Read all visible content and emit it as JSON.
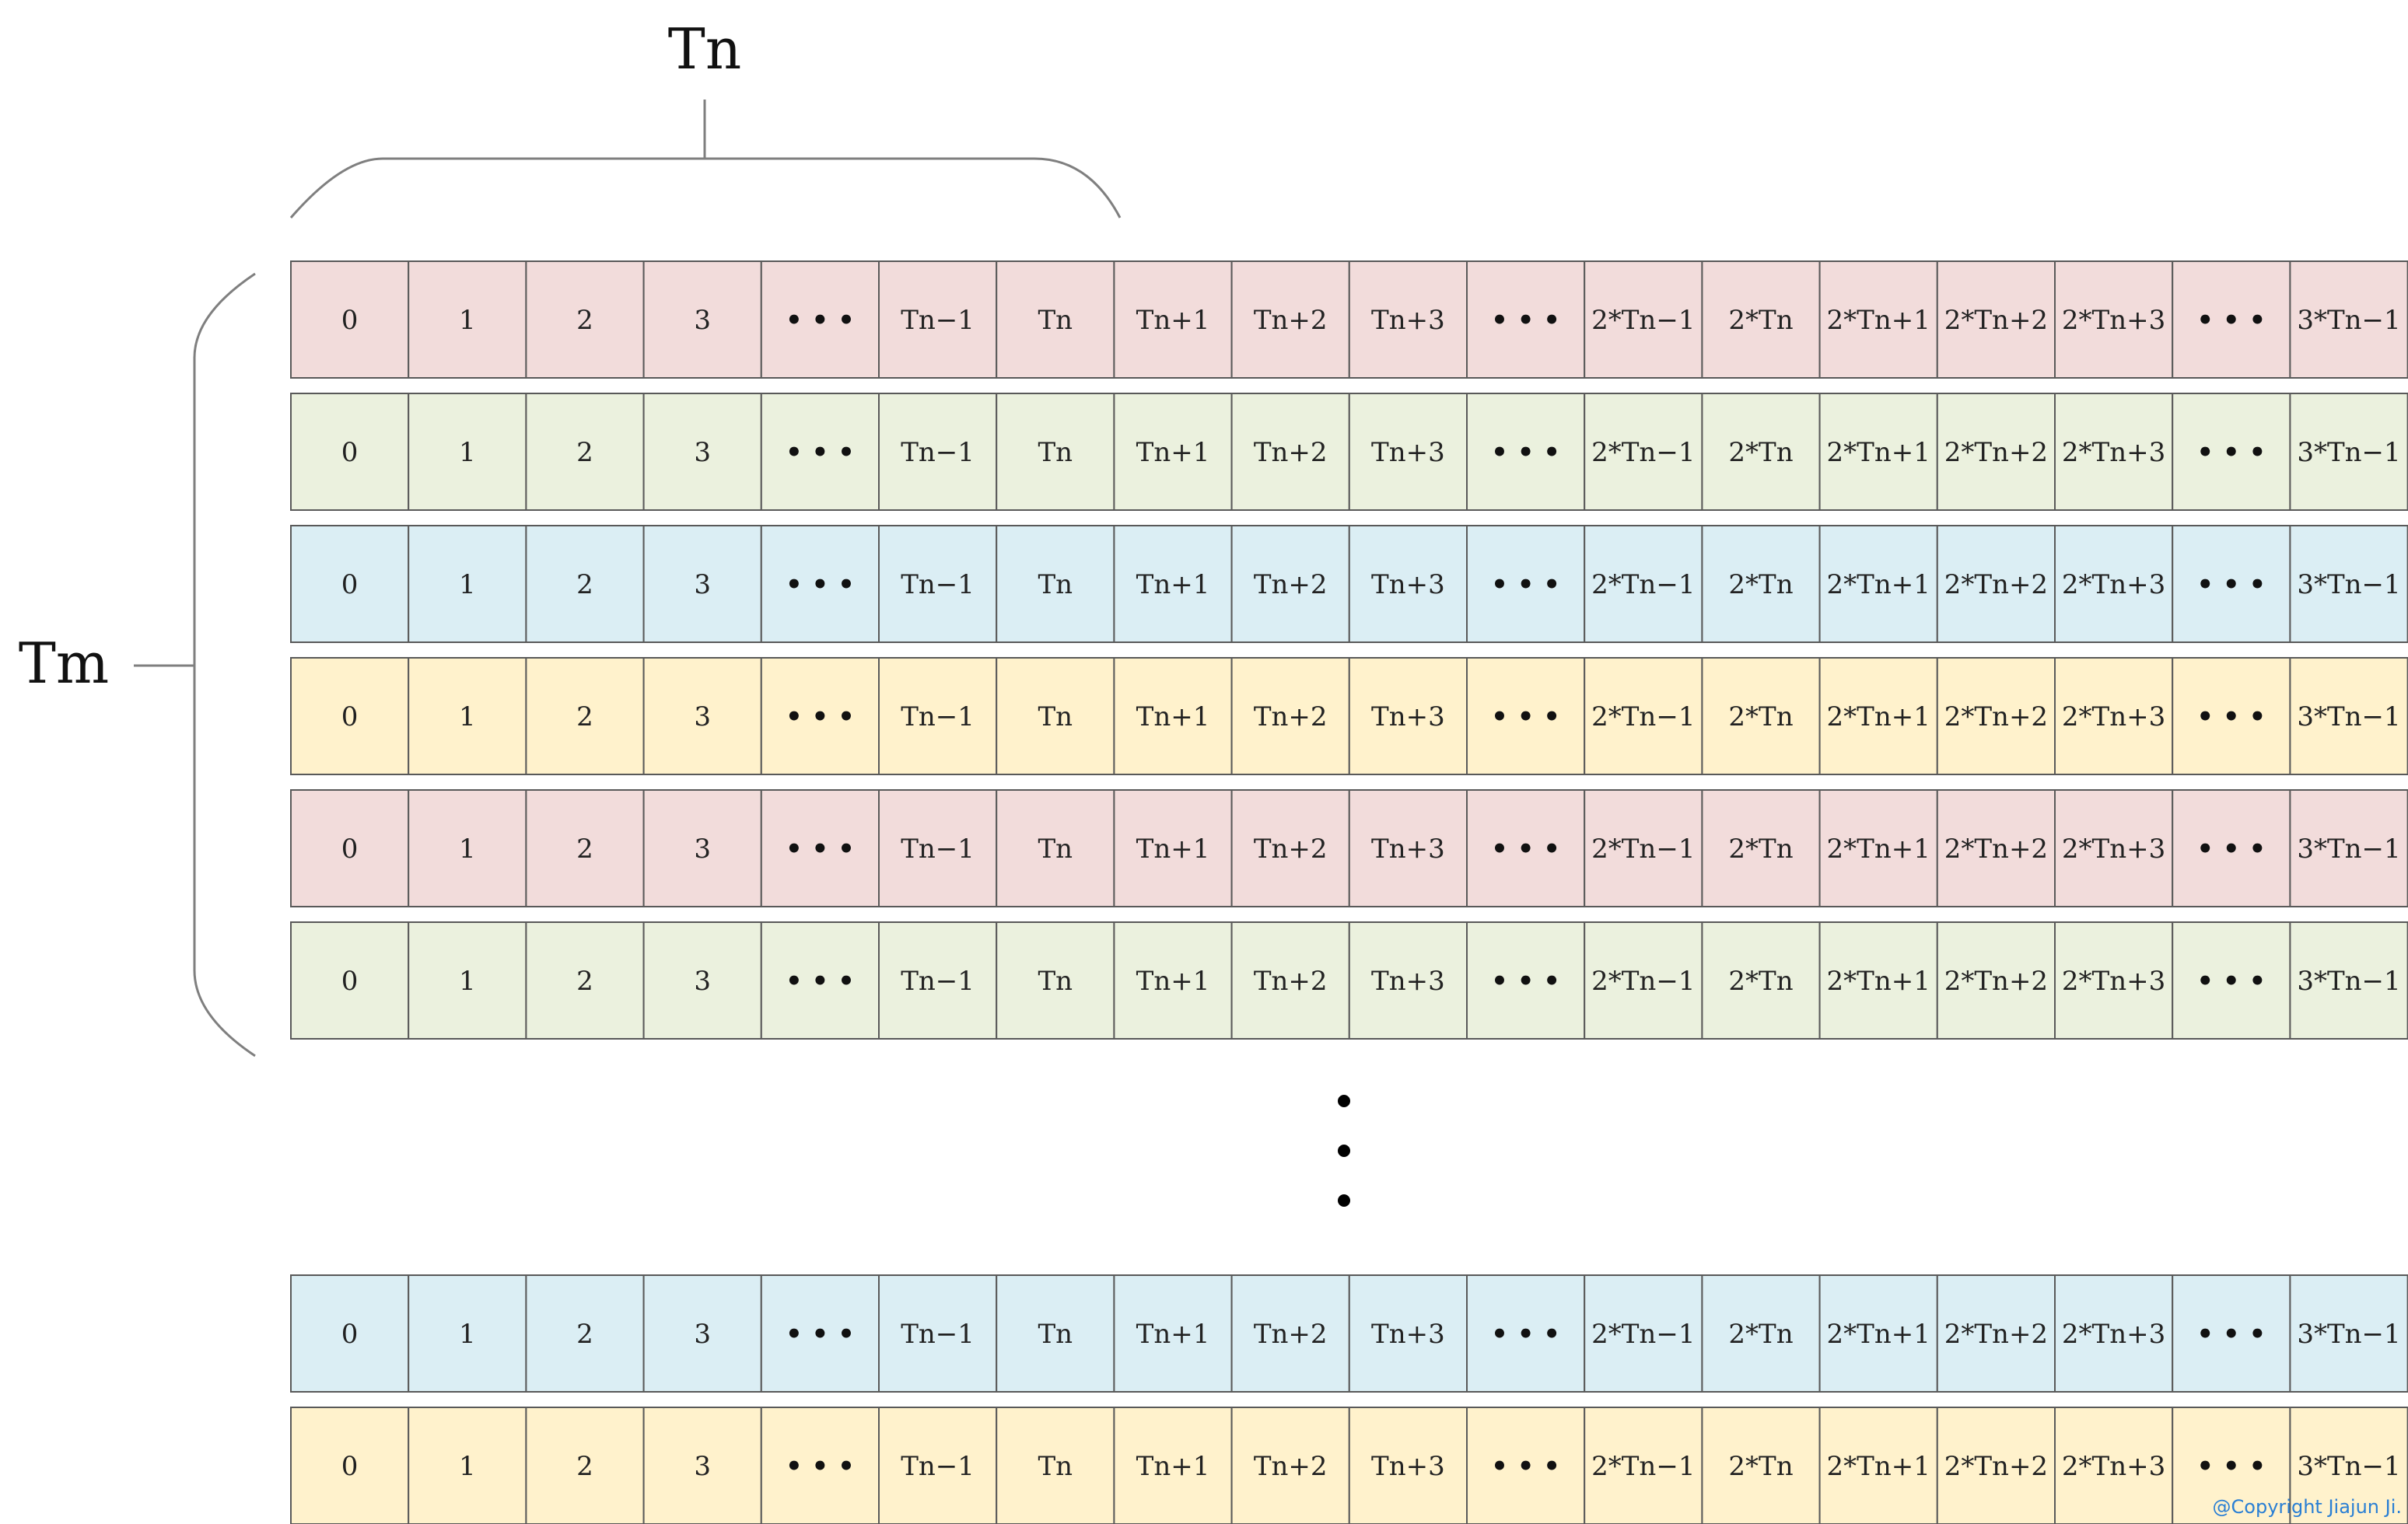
{
  "labels": {
    "columns_brace": "Tn",
    "rows_brace": "Tm",
    "copyright": "@Copyright Jiajun Ji."
  },
  "columns": [
    "0",
    "1",
    "2",
    "3",
    "• • •",
    "Tn−1",
    "Tn",
    "Tn+1",
    "Tn+2",
    "Tn+3",
    "• • •",
    "2*Tn−1",
    "2*Tn",
    "2*Tn+1",
    "2*Tn+2",
    "2*Tn+3",
    "• • •",
    "3*Tn−1"
  ],
  "row_colors": [
    "#f2dcdb",
    "#ebf1de",
    "#dbeef4",
    "#fff2cc",
    "#f2dcdb",
    "#ebf1de",
    "#dbeef4",
    "#fff2cc"
  ],
  "colors": {
    "red": "#f2dcdb",
    "green": "#ebf1de",
    "blue": "#dbeef4",
    "yellow": "#fff2cc",
    "cell_border": "#595959",
    "brace": "#7f7f7f"
  },
  "ellipsis": "vertical-dots"
}
